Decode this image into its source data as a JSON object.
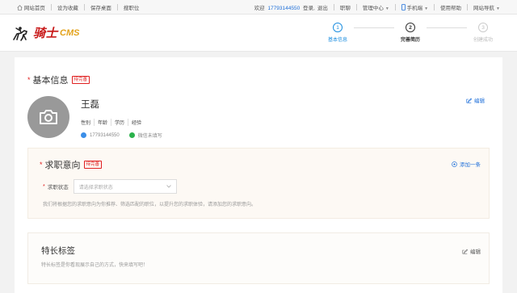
{
  "topbar": {
    "left_links": [
      "网站首页",
      "设为收藏",
      "保存桌面",
      "搜职位"
    ],
    "welcome": "欢迎",
    "phone": "17793144550",
    "login_label": "登录,",
    "logout_label": "退出",
    "links_right": [
      "职聊",
      "管理中心",
      "手机端",
      "使用帮助",
      "网站导航"
    ]
  },
  "brand": {
    "cn": "骑士",
    "en": "CMS"
  },
  "steps": [
    {
      "num": "1",
      "label": "基本信息"
    },
    {
      "num": "2",
      "label": "完善简历"
    },
    {
      "num": "3",
      "label": "创建成功"
    }
  ],
  "basic": {
    "title": "基本信息",
    "badge": "待完善",
    "edit_label": "编辑",
    "name": "王磊",
    "tags": [
      "性别",
      "年龄",
      "学历",
      "经验"
    ],
    "phone": "17793144550",
    "wechat": "微信未填写"
  },
  "intent": {
    "title": "求职意向",
    "badge": "待完善",
    "add_label": "添加一条",
    "status_label": "求职状态",
    "status_placeholder": "请选择求职状态",
    "hint": "我们将根据您的求职意向为你推荐、筛选匹配的职位，以提升您的求职体验，请添加您的求职意向。"
  },
  "skills": {
    "title": "特长标签",
    "desc": "特长标签是你看现展示自己的方式，快来填写吧！",
    "edit_label": "编辑"
  },
  "colors": {
    "accent": "#1e8fe0",
    "link": "#1e6fd9",
    "danger": "#e02020",
    "brand_red": "#c81919",
    "brand_gold": "#e3a21a"
  }
}
